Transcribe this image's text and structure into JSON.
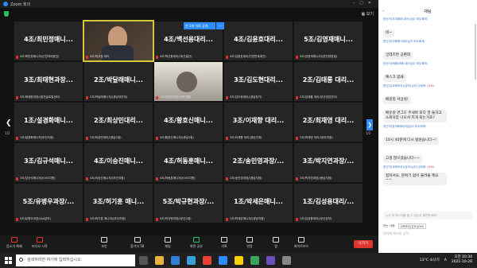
{
  "window": {
    "title": "Zoom 회의"
  },
  "stage": {
    "view_label": "보기"
  },
  "tiles": [
    {
      "big": "4조/최민정매니...",
      "small": "4조/최민정매니저(신천마이발전)",
      "type": "plain"
    },
    {
      "big": "",
      "small": "4조/최교정 대리",
      "type": "video"
    },
    {
      "big": "4조/백선용대리...",
      "small": "4조/백선용대리/(위산결산)",
      "type": "plain"
    },
    {
      "big": "4조/김윤호대리...",
      "small": "4조/김윤호대리/인천판촉계관)",
      "type": "plain"
    },
    {
      "big": "5조/김영재매니...",
      "small": "5조/김영재매니저/(운천영업팀)",
      "type": "plain"
    },
    {
      "big": "3조/최태현과장...",
      "small": "3조/최태현과장/(홍천글로벌센터)",
      "type": "plain"
    },
    {
      "big": "2조/박달래매니...",
      "small": "2조/박달래매니저/(경남대관계)",
      "type": "plain"
    },
    {
      "big": "",
      "small": "1조/임영균부장(천북지점)",
      "type": "video2"
    },
    {
      "big": "3조/김도현대리...",
      "small": "3조/김도현대리/(경남정기)",
      "type": "plain"
    },
    {
      "big": "2조/김태롱 대리...",
      "small": "2조/김태롱 대리(부산영업관리)",
      "type": "plain"
    },
    {
      "big": "1조/설경화매니...",
      "small": "1조/설경화매니저(부산지점)",
      "type": "plain"
    },
    {
      "big": "2조/최상민대리...",
      "small": "2조/최상민대리/(경남2점)",
      "type": "plain"
    },
    {
      "big": "4조/황호신매니...",
      "small": "4조/황호신매니저/(경남2점)",
      "type": "plain"
    },
    {
      "big": "3조/이재향 대리...",
      "small": "3조/이재향 대리(경남관계)",
      "type": "plain"
    },
    {
      "big": "2조/최재영 대리...",
      "small": "2조/최재영 대리/(동부지점)",
      "type": "plain"
    },
    {
      "big": "3조/김규석매니...",
      "small": "3조/김규석매니저/(OSS지원)",
      "type": "plain"
    },
    {
      "big": "4조/이승진매니...",
      "small": "4조/이승진매니저/(부산지점)",
      "type": "plain"
    },
    {
      "big": "4조/허동훈매니...",
      "small": "4조/허동훈매니저/(OSS지원)",
      "type": "plain"
    },
    {
      "big": "2조/송민영과장/...",
      "small": "2조/송민영과장/(경남지점)",
      "type": "plain"
    },
    {
      "big": "3조/박지연과장/...",
      "small": "3조/박지연과장/(동남지점)",
      "type": "plain"
    },
    {
      "big": "5조/유병우과장/...",
      "small": "5조/유병우과장/(AA본부)",
      "type": "plain"
    },
    {
      "big": "3조/허기훈 매니...",
      "small": "3조/허기훈 매니저/(부산지점)",
      "type": "plain"
    },
    {
      "big": "5조/박규현과장/...",
      "small": "5조/박규현과장/(부산2점)",
      "type": "plain"
    },
    {
      "big": "1조/박세은매니...",
      "small": "1조/박세은매니저/(경남지점)",
      "type": "plain"
    },
    {
      "big": "1조/김성용대리/...",
      "small": "1조/김성용대리/(부산본부)",
      "type": "plain"
    }
  ],
  "badges": {
    "raised": "손 5개 자료 공개",
    "more": "..."
  },
  "pagination": {
    "left": "1/2",
    "right": "1/2"
  },
  "toolbar": {
    "mute": "음소거 해제",
    "video": "비디오 시작",
    "security": "보안",
    "participants": "참가자",
    "participants_count": "58",
    "chat": "채팅",
    "share": "화면 공유",
    "record": "기록",
    "reactions": "반응",
    "apps": "앱",
    "whiteboard": "화이트보드",
    "leave": "나가기"
  },
  "chat": {
    "title": "채팅",
    "messages": [
      {
        "sender": "방신자(조이해매 대리)님이 모두에게:",
        "private": "",
        "text": "네~"
      },
      {
        "sender": "방신자(이해매 대리)님이 모두에게:",
        "private": "",
        "text": "궁데즈면 공편데"
      },
      {
        "sender": "방신자(매해)매매 대리님이 모두에게:",
        "private": "",
        "text": "예스크 없쇄"
      },
      {
        "sender": "방신자(교육조무)(강조)님이 나에게:",
        "private": "(DM)",
        "text": "배중정 서상실!"
      },
      {
        "sender": "",
        "private": "",
        "text": "배운원 면그도 주세바 되다 말 들하고 소회의장 나오서 지개 되는거죠?"
      },
      {
        "sender": "방신자(방)매매비(매)님이 모두에게:",
        "private": "",
        "text": "10시 40분에 다시 법원습니다~!"
      },
      {
        "sender": "",
        "private": "",
        "text": "고생 많으셨습니다~~"
      },
      {
        "sender": "방신자(교육조무)(강조)님이 나에게:",
        "private": "(DM)",
        "text": "접자서요, 분위기 없어 울려올 께요 ^^"
      }
    ],
    "notice": "누가 이 메시지를 볼 수 있는지 확인하세요?",
    "to_label": "받는 사람:",
    "to_value": "교육조무(강조)(DM)",
    "input_placeholder": "여기에 메시지 입력..."
  },
  "taskbar": {
    "search_placeholder": "검색하려면 여기에 입력하십시오.",
    "weather": "13°C 소나기",
    "lang": "A",
    "time": "오전 10:34",
    "date": "2021-10-28"
  },
  "colors": {
    "accent": "#2d8cff",
    "leave": "#e0342e",
    "shield": "#23c45e",
    "active_speaker": "#d4c83a"
  }
}
